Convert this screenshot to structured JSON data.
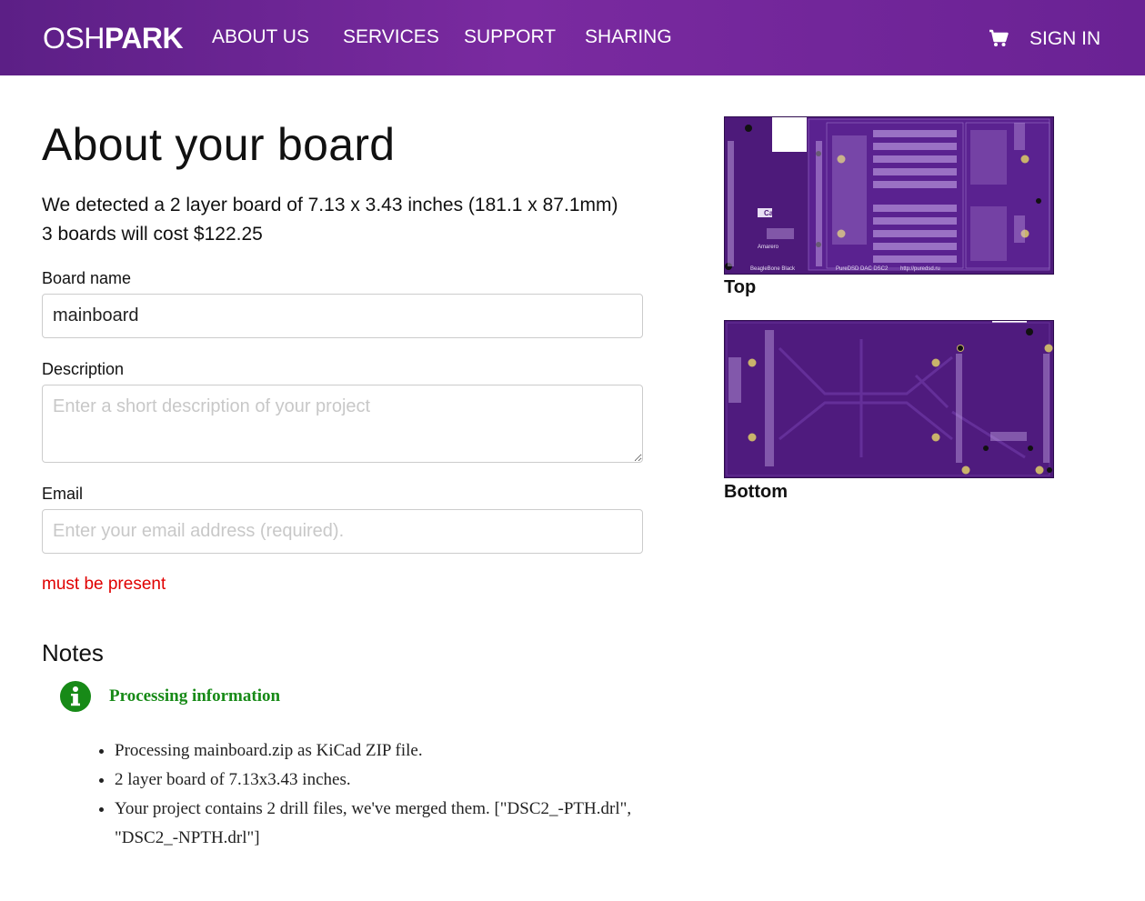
{
  "nav": {
    "logo_thin": "OSH",
    "logo_bold": "PARK",
    "items": [
      {
        "label": "ABOUT US"
      },
      {
        "label": "SERVICES"
      },
      {
        "label": "SUPPORT"
      },
      {
        "label": "SHARING"
      }
    ],
    "cart_icon": "shopping-cart-icon",
    "signin": "SIGN IN"
  },
  "page": {
    "title": "About your board",
    "detect_line": "We detected a 2 layer board of 7.13 x 3.43 inches (181.1 x 87.1mm)",
    "cost_line": "3 boards will cost $122.25"
  },
  "form": {
    "board_name_label": "Board name",
    "board_name_value": "mainboard",
    "description_label": "Description",
    "description_placeholder": "Enter a short description of your project",
    "email_label": "Email",
    "email_placeholder": "Enter your email address (required).",
    "email_error": "must be present"
  },
  "notes": {
    "title": "Notes",
    "info_icon": "info-icon",
    "processing_title": "Processing information",
    "items": [
      "Processing mainboard.zip as KiCad ZIP file.",
      "2 layer board of 7.13x3.43 inches.",
      "Your project contains 2 drill files, we've merged them. [\"DSC2_-PTH.drl\", \"DSC2_-NPTH.drl\"]"
    ]
  },
  "previews": {
    "top_caption": "Top",
    "bottom_caption": "Bottom",
    "top_texts": {
      "brand": "Cad",
      "a": "Amarero",
      "b": "BeagleBone Black",
      "c": "PureDSD DAC DSC2",
      "d": "http://puredsd.ru"
    }
  },
  "colors": {
    "nav_purple": "#6e2598",
    "board_purple": "#4d1a7a",
    "error_red": "#e00000",
    "info_green": "#178a17"
  }
}
